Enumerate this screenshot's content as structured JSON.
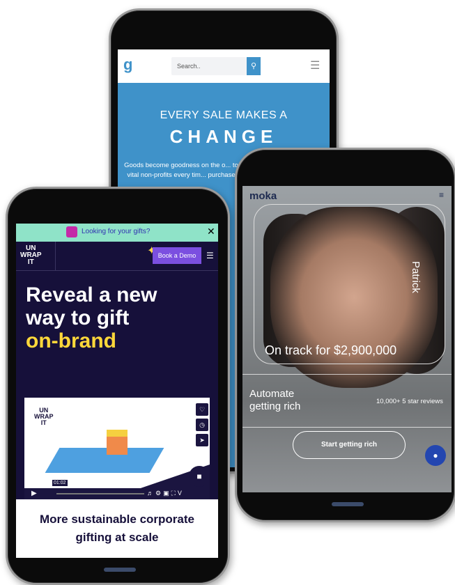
{
  "back_phone": {
    "search_placeholder": "Search..",
    "hero_line1": "EVERY SALE MAKES A",
    "hero_line2": "CHANGE",
    "body_text": "Goods become goodness on the o... to vital non-profits every tim... purchase"
  },
  "right_phone": {
    "logo": "moka",
    "person_name": "Patrick",
    "track_text": "On track for $2,900,000",
    "automate_line1": "Automate",
    "automate_line2": "getting rich",
    "reviews": "10,000+ 5 star reviews",
    "cta": "Start getting rich"
  },
  "left_phone": {
    "banner_text": "Looking for your gifts?",
    "logo_lines": [
      "UN",
      "WRAP",
      "IT"
    ],
    "book_demo": "Book a Demo",
    "headline_line1": "Reveal a new",
    "headline_line2": "way to gift",
    "headline_line3": "on-brand",
    "video_time": "01:02",
    "subheadline_line1": "More sustainable corporate",
    "subheadline_line2": "gifting at scale"
  },
  "colors": {
    "blue_brand": "#3f92c9",
    "unwrap_bg": "#16103a",
    "unwrap_accent": "#ffd83a",
    "banner_green": "#8fe3c8",
    "moka_navy": "#1d2a50"
  }
}
